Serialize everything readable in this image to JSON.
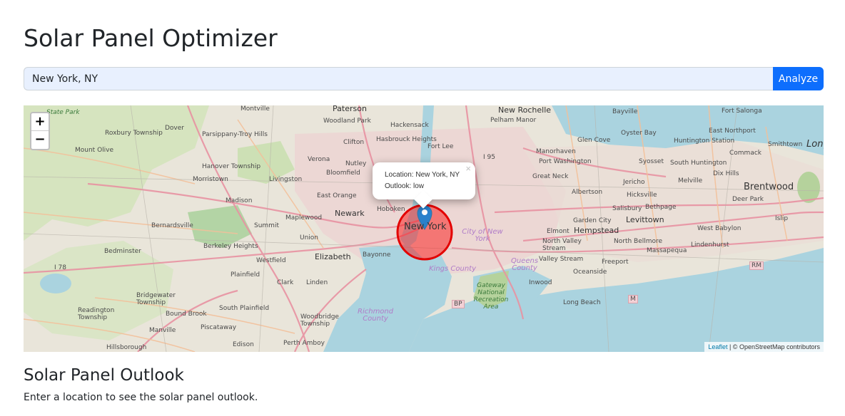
{
  "header": {
    "title": "Solar Panel Optimizer"
  },
  "search": {
    "value": "New York, NY",
    "button_label": "Analyze"
  },
  "map": {
    "zoom_in": "+",
    "zoom_out": "−",
    "popup": {
      "close": "×",
      "location_line": "Location: New York, NY",
      "outlook_line": "Outlook: low"
    },
    "attribution": {
      "leaflet": "Leaflet",
      "osm": "| © OpenStreetMap contributors"
    },
    "circle_color": "#ff0000",
    "marker_color": "#2a81cb",
    "places": [
      "Paterson",
      "Montville",
      "New Rochelle",
      "Bayville",
      "Fort Salonga",
      "Roxbury Township",
      "Dover",
      "Parsippany-Troy Hills",
      "Woodland Park",
      "Hackensack",
      "Pelham Manor",
      "Oyster Bay",
      "East Northport",
      "Mount Olive",
      "Clifton",
      "Hasbrouck Heights",
      "Fort Lee",
      "I 95",
      "Glen Cove",
      "Huntington Station",
      "Commack",
      "Smithtown",
      "Long",
      "Hanover Township",
      "Verona",
      "Nutley",
      "Manorhaven",
      "Port Washington",
      "Syosset",
      "South Huntington",
      "Dix Hills",
      "Morristown",
      "Livingston",
      "Bloomfield",
      "Great Neck",
      "Jericho",
      "Melville",
      "Brentwood",
      "East Orange",
      "Albertson",
      "Hicksville",
      "Deer Park",
      "Madison",
      "Newark",
      "Hoboken",
      "Salisbury",
      "Bethpage",
      "Maplewood",
      "New York",
      "Garden City",
      "Levittown",
      "Islip",
      "Bernardsville",
      "Summit",
      "City of New York",
      "Elmont",
      "Hempstead",
      "West Babylon",
      "Union",
      "North Valley Stream",
      "North Bellmore",
      "Lindenhurst",
      "Berkeley Heights",
      "Elizabeth",
      "Bayonne",
      "Valley Stream",
      "Massapequa",
      "Bedminster",
      "Westfield",
      "Freeport",
      "I 78",
      "Plainfield",
      "Kings County",
      "Queens County",
      "Oceanside",
      "RM",
      "Clark",
      "Linden",
      "Inwood",
      "Bridgewater Township",
      "Gateway National Recreation Area",
      "Long Beach",
      "South Plainfield",
      "Woodbridge Township",
      "Richmond County",
      "BP",
      "M",
      "Readington Township",
      "Bound Brook",
      "Manville",
      "Piscataway",
      "Hillsborough",
      "Edison",
      "Perth Amboy",
      "State Park"
    ]
  },
  "outlook": {
    "title": "Solar Panel Outlook",
    "text": "Enter a location to see the solar panel outlook."
  }
}
